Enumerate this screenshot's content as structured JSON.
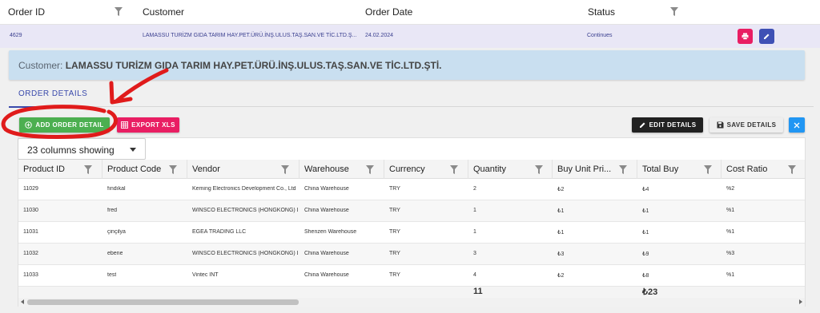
{
  "orders_grid": {
    "headers": [
      "Order ID",
      "Customer",
      "Order Date",
      "Status"
    ],
    "row": {
      "order_id": "4629",
      "customer": "LAMASSU TURİZM GIDA TARIM HAY.PET.ÜRÜ.İNŞ.ULUS.TAŞ.SAN.VE TİC.LTD.Ş...",
      "order_date": "24.02.2024",
      "status": "Continues"
    },
    "row_actions": [
      {
        "name": "print",
        "icon": "printer-icon",
        "color": "#e91e63"
      },
      {
        "name": "edit",
        "icon": "pencil-icon",
        "color": "#3f51b5"
      }
    ]
  },
  "detail": {
    "customer_label": "Customer:",
    "customer_name": "LAMASSU TURİZM GIDA TARIM HAY.PET.ÜRÜ.İNŞ.ULUS.TAŞ.SAN.VE TİC.LTD.ŞTİ.",
    "tab": "ORDER DETAILS",
    "toolbar": {
      "add_label": "ADD ORDER DETAIL",
      "export_label": "EXPORT XLS",
      "edit_label": "EDIT DETAILS",
      "save_label": "SAVE DETAILS"
    },
    "columns_select": "23 columns showing",
    "columns": [
      "Product ID",
      "Product Code",
      "Vendor",
      "Warehouse",
      "Currency",
      "Quantity",
      "Buy Unit Pri...",
      "Total Buy",
      "Cost Ratio"
    ],
    "rows": [
      [
        "11029",
        "fındıkal",
        "Keming Electronics Development Co., Ltd",
        "China Warehouse",
        "TRY",
        "2",
        "₺2",
        "₺4",
        "%2"
      ],
      [
        "11030",
        "fred",
        "WINSCO ELECTRONICS (HONGKONG) L...",
        "China Warehouse",
        "TRY",
        "1",
        "₺1",
        "₺1",
        "%1"
      ],
      [
        "11031",
        "çinçilya",
        "EGEA TRADING LLC",
        "Shenzen Warehouse",
        "TRY",
        "1",
        "₺1",
        "₺1",
        "%1"
      ],
      [
        "11032",
        "ebene",
        "WINSCO ELECTRONICS (HONGKONG) L...",
        "China Warehouse",
        "TRY",
        "3",
        "₺3",
        "₺9",
        "%3"
      ],
      [
        "11033",
        "test",
        "Vintec INT",
        "China Warehouse",
        "TRY",
        "4",
        "₺2",
        "₺8",
        "%1"
      ]
    ],
    "totals": {
      "quantity": "11",
      "total_buy": "₺23"
    }
  },
  "colors": {
    "row_highlight": "#e9e7f6",
    "customer_box": "#c9dff0",
    "tab_accent": "#3949ab",
    "add_button": "#4caf50",
    "export_button": "#e91e63",
    "edit_button": "#212121",
    "close_button": "#2196f3",
    "annotation": "#e01b1b"
  },
  "annotation": {
    "shape": "red-circle-and-arrow",
    "target": "add-order-detail-button"
  }
}
